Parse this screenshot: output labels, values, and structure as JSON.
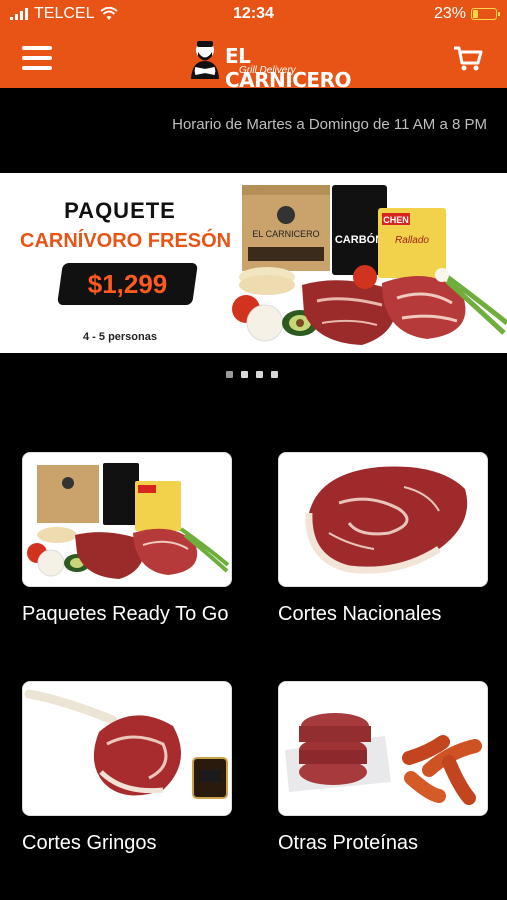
{
  "status_bar": {
    "carrier": "TELCEL",
    "time": "12:34",
    "battery_percent": "23%",
    "battery_level": 0.23,
    "battery_color": "#ffd84a"
  },
  "navbar": {
    "background": "#e75416",
    "logo_text": "EL CARNICERO",
    "logo_subtitle": "Grill Delivery",
    "menu_icon": "hamburger-menu-icon",
    "cart_icon": "shopping-cart-icon"
  },
  "schedule": "Horario de Martes a Domingo de 11 AM a 8 PM",
  "banner": {
    "title_line1": "PAQUETE",
    "title_line2": "CARNÍVORO FRESÓN",
    "price": "$1,299",
    "people": "4 - 5 personas",
    "box_label": "EL CARNICERO",
    "bag_label": "CARBÓN",
    "chips_brand": "CHEN",
    "chips_label": "Rallado"
  },
  "carousel": {
    "slides": 4,
    "active_index": 0
  },
  "categories": [
    {
      "label": "Paquetes Ready To Go"
    },
    {
      "label": "Cortes Nacionales"
    },
    {
      "label": "Cortes Gringos"
    },
    {
      "label": "Otras Proteínas"
    }
  ]
}
